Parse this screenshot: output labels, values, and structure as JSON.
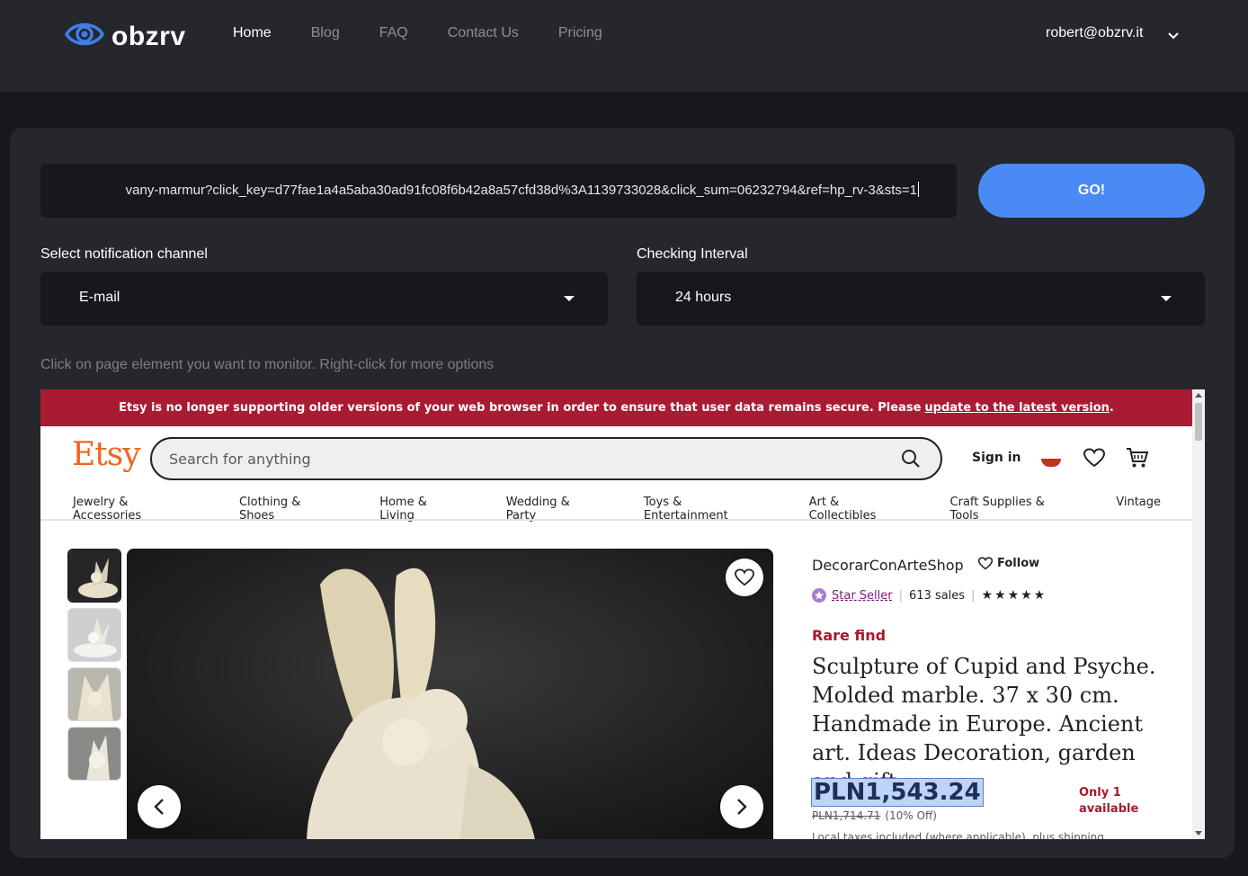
{
  "brand": {
    "name": "obzrv"
  },
  "nav": {
    "items": [
      "Home",
      "Blog",
      "FAQ",
      "Contact Us",
      "Pricing"
    ],
    "active": "Home"
  },
  "account": {
    "email": "robert@obzrv.it"
  },
  "url_input": {
    "value": "vany-marmur?click_key=d77fae1a4a5aba30ad91fc08f6b42a8a57cfd38d%3A1139733028&click_sum=06232794&ref=hp_rv-3&sts=1"
  },
  "go_button": {
    "label": "GO!"
  },
  "notification": {
    "label": "Select notification channel",
    "value": "E-mail"
  },
  "interval": {
    "label": "Checking Interval",
    "value": "24 hours"
  },
  "hint": "Click on page element you want to monitor. Right-click for more options",
  "colors": {
    "accent": "#4a8af4",
    "etsy_orange": "#f1641e",
    "banner_red": "#a81b33",
    "highlight": "#bcd4f6"
  },
  "etsy": {
    "banner": {
      "text": "Etsy is no longer supporting older versions of your web browser in order to ensure that user data remains secure. Please",
      "link": "update to the latest version",
      "end": "."
    },
    "logo": "Etsy",
    "search_placeholder": "Search for anything",
    "sign_in": "Sign in",
    "categories": [
      "Jewelry & Accessories",
      "Clothing & Shoes",
      "Home & Living",
      "Wedding & Party",
      "Toys & Entertainment",
      "Art & Collectibles",
      "Craft Supplies & Tools",
      "Vintage"
    ],
    "shop_name": "DecorarConArteShop",
    "follow": "Follow",
    "star_seller": "Star Seller",
    "sales": "613 sales",
    "stars": "★★★★★",
    "rating": 5,
    "rare_find": "Rare find",
    "title": "Sculpture of Cupid and Psyche. Molded marble. 37 x 30 cm. Handmade in Europe. Ancient art. Ideas Decoration, garden and gift.",
    "price": "PLN1,543.24",
    "availability": "Only 1 available",
    "old_price": "PLN1,714.71",
    "discount": "(10% Off)",
    "taxes": "Local taxes included (where applicable), plus shipping"
  }
}
